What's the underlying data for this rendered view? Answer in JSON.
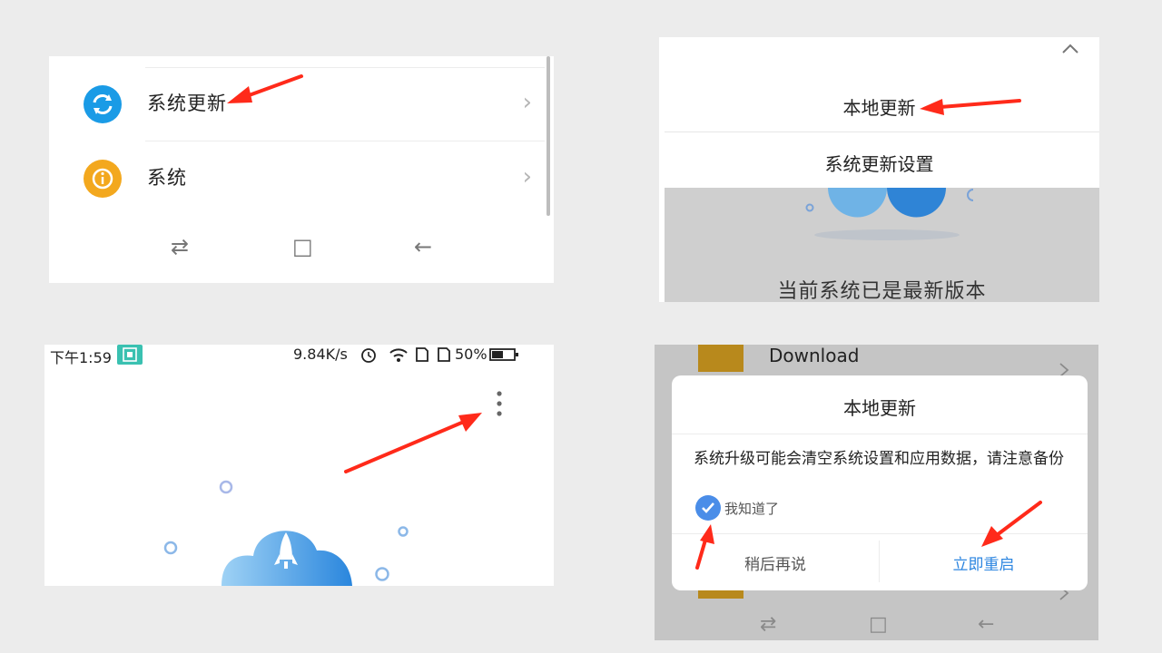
{
  "panel1": {
    "items": [
      {
        "label": "系统更新",
        "icon": "sync-icon",
        "icon_color": "#1a9be6"
      },
      {
        "label": "系统",
        "icon": "info-icon",
        "icon_color": "#f3a81e"
      }
    ],
    "chevron": "›",
    "nav": {
      "switch": "⇄",
      "home": "□",
      "back": "←"
    }
  },
  "panel2": {
    "collapse_icon": "chevron-up-icon",
    "menu": [
      "本地更新",
      "系统更新设置"
    ],
    "status_text": "当前系统已是最新版本"
  },
  "panel3": {
    "status_bar": {
      "time": "下午1:59",
      "speed": "9.84K/s",
      "battery": "50%"
    },
    "more_icon": "more-vertical-icon"
  },
  "panel4": {
    "background_folder": "Download",
    "dialog": {
      "title": "本地更新",
      "message": "系统升级可能会清空系统设置和应用数据，请注意备份",
      "checkbox_label": "我知道了",
      "checkbox_checked": true,
      "cancel_label": "稍后再说",
      "confirm_label": "立即重启"
    }
  },
  "colors": {
    "accent_blue": "#1a9be6",
    "warning_orange": "#f3a81e",
    "annotation_red": "#ff2a1a",
    "checkbox_blue": "#4a8de8",
    "confirm_blue": "#2d86e0"
  }
}
